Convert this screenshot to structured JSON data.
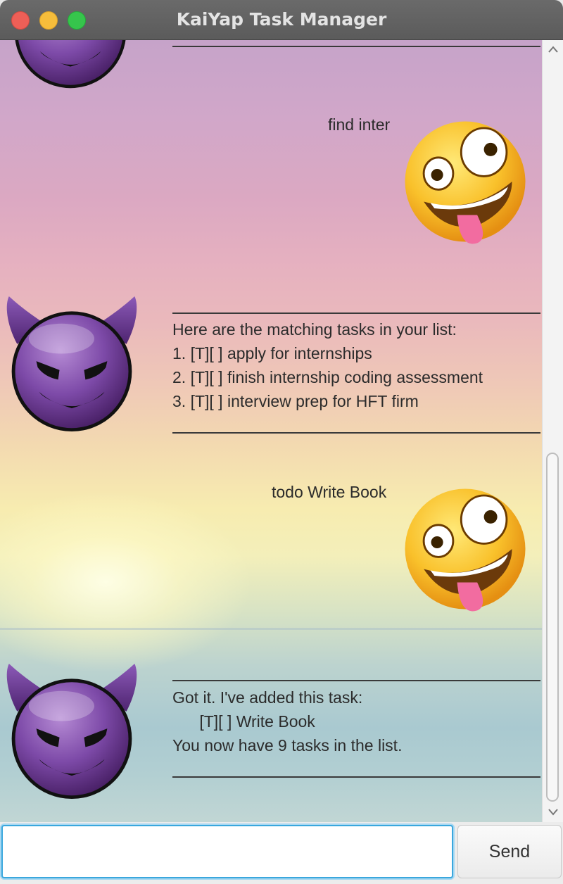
{
  "window": {
    "title": "KaiYap Task Manager"
  },
  "chat": {
    "divider": "________________________________________",
    "messages": [
      {
        "sender": "user",
        "text": "find inter"
      },
      {
        "sender": "bot",
        "lines": [
          "Here are the matching tasks in your list:",
          "1. [T][ ] apply for internships",
          "2. [T][ ] finish internship coding assessment",
          "3. [T][ ] interview prep for HFT firm"
        ]
      },
      {
        "sender": "user",
        "text": "todo Write Book"
      },
      {
        "sender": "bot",
        "lines": [
          "Got it. I've added this task:",
          "      [T][ ] Write Book",
          "You now have 9 tasks in the list."
        ]
      }
    ]
  },
  "avatars": {
    "user": "zany-face-emoji",
    "bot": "smiling-devil-emoji"
  },
  "input": {
    "value": "",
    "placeholder": ""
  },
  "send_button": {
    "label": "Send"
  },
  "colors": {
    "input_focus": "#3aa7dd",
    "traffic_close": "#ee5f57",
    "traffic_min": "#f6bd3b",
    "traffic_max": "#36c54c"
  }
}
